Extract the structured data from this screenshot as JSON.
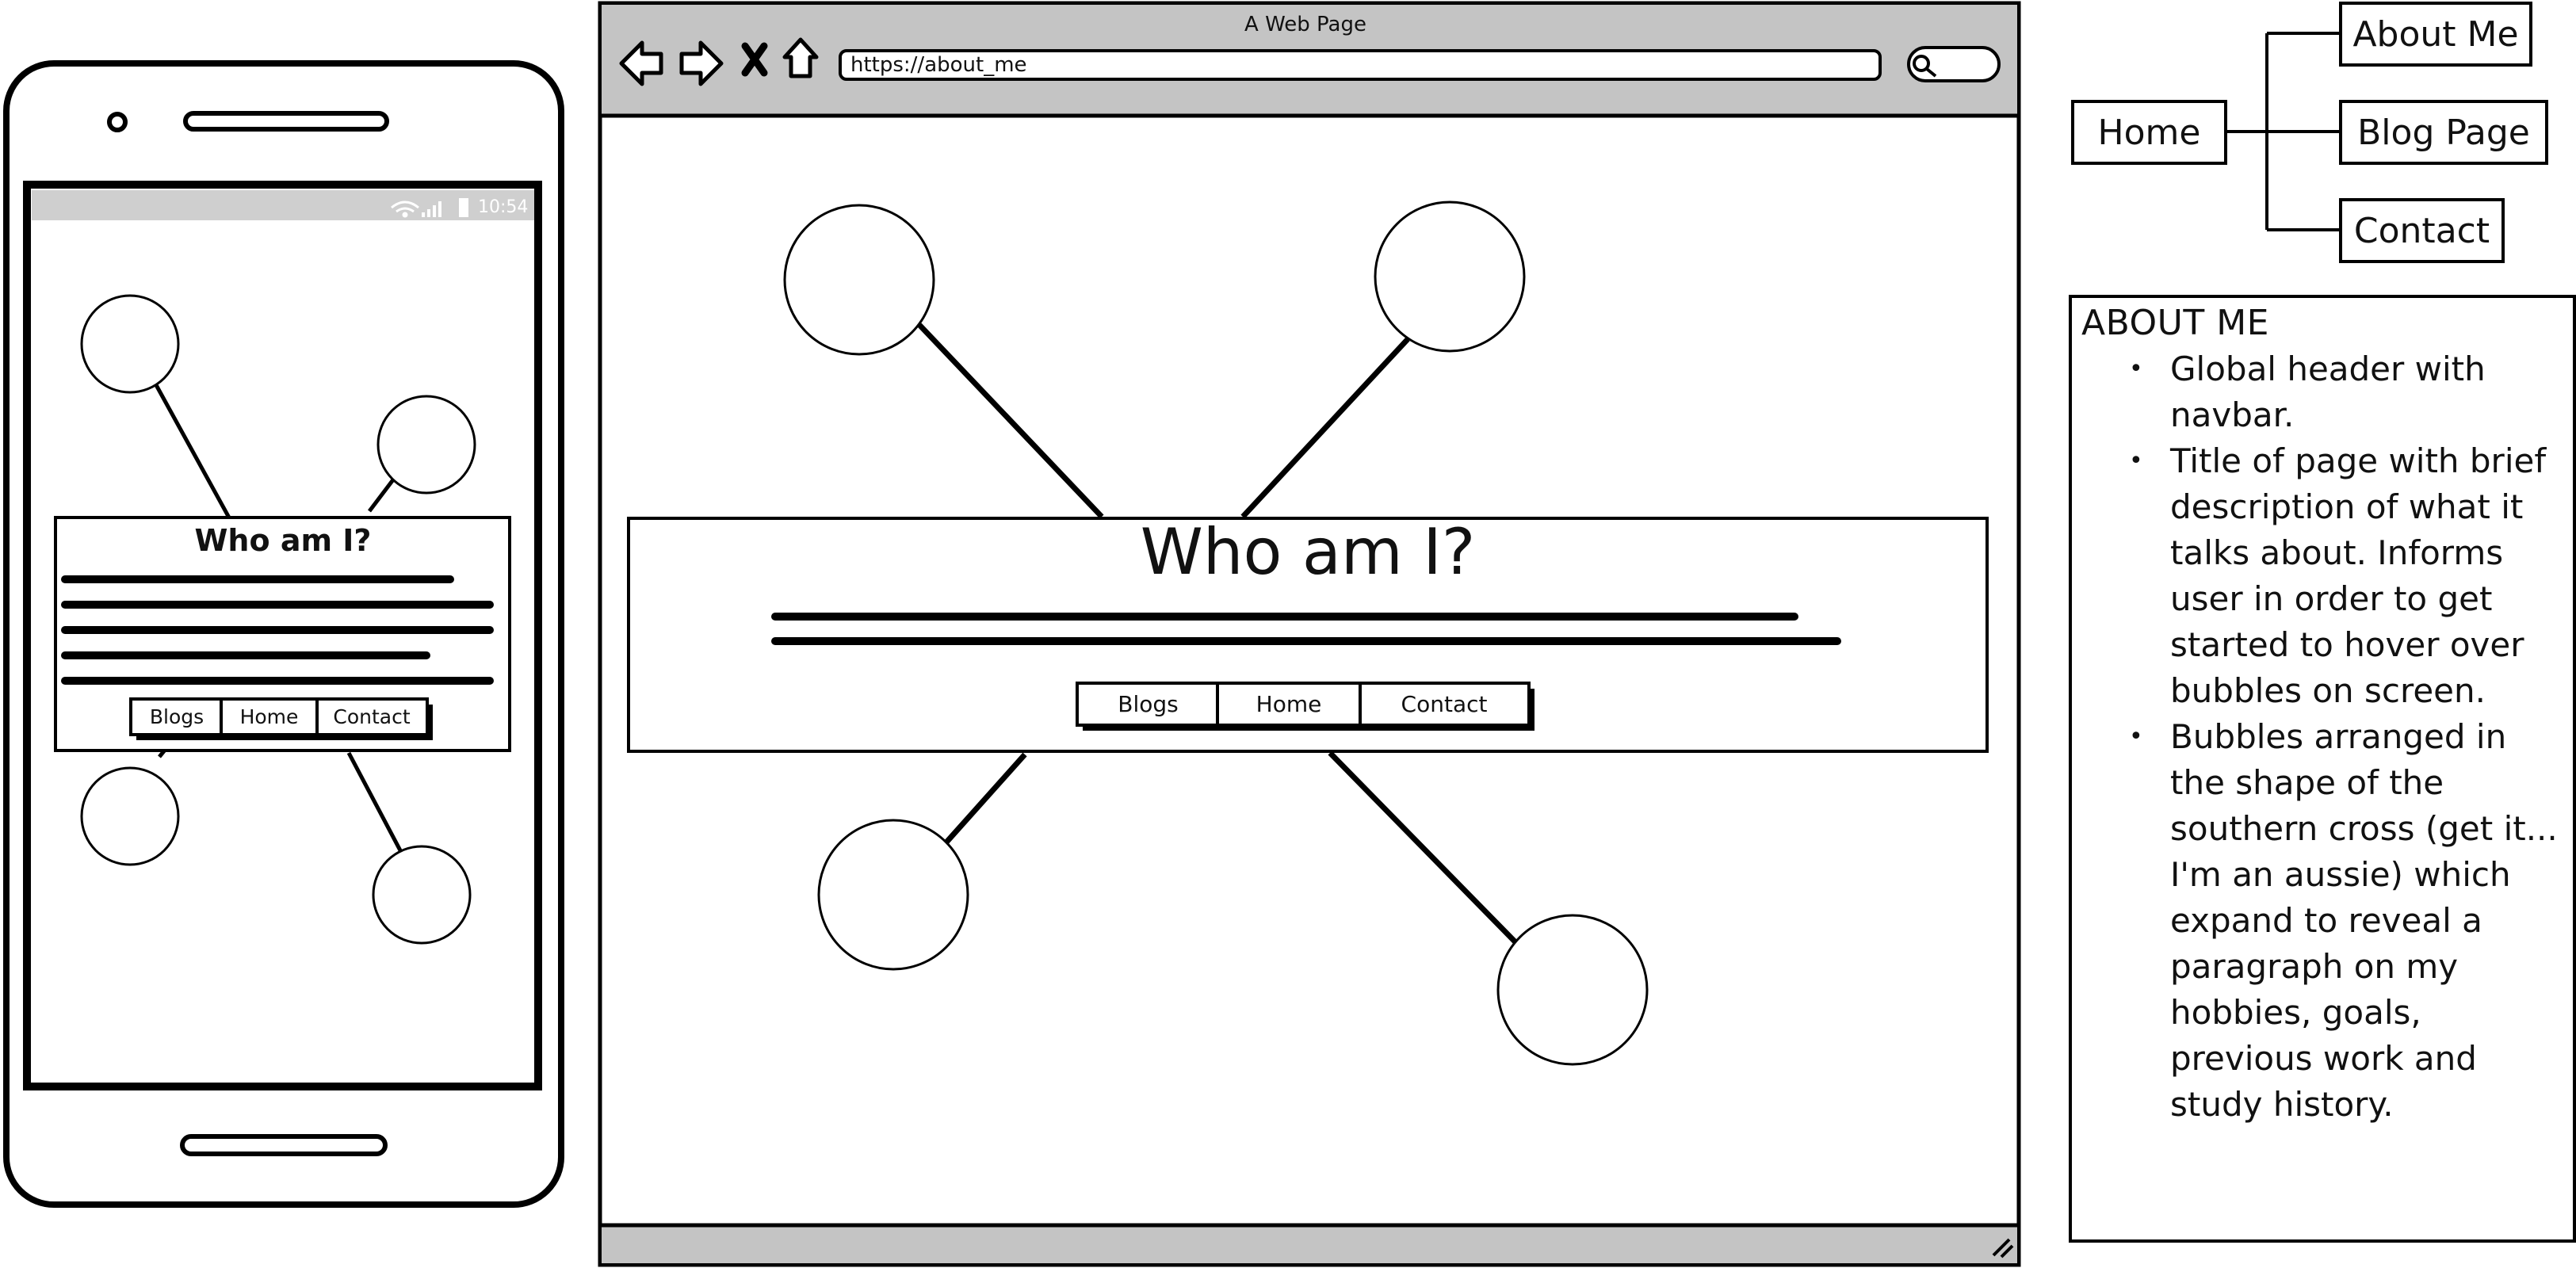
{
  "browser": {
    "title": "A Web Page",
    "url": "https://about_me"
  },
  "desktop": {
    "heading": "Who am I?",
    "nav": [
      "Blogs",
      "Home",
      "Contact"
    ]
  },
  "mobile": {
    "status_time": "10:54",
    "heading": "Who am I?",
    "nav": [
      "Blogs",
      "Home",
      "Contact"
    ]
  },
  "sitemap": {
    "root": "Home",
    "children": [
      "About Me",
      "Blog Page",
      "Contact"
    ]
  },
  "notes": {
    "heading": "ABOUT ME",
    "items": [
      "Global header with navbar.",
      "Title of page with brief description of what it talks about. Informs user in order to get started to hover over bubbles on screen.",
      "Bubbles arranged in the shape of the southern cross (get it... I'm an aussie) which expand to reveal a paragraph on my hobbies, goals, previous work and study history."
    ]
  }
}
